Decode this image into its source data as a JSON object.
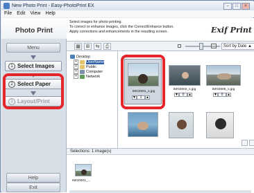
{
  "window": {
    "title": "New Photo Print - Easy-PhotoPrint EX",
    "controls": [
      "–",
      "□",
      "×"
    ]
  },
  "menu": [
    "File",
    "Edit",
    "View",
    "Help"
  ],
  "sidebar": {
    "brand": "Photo Print",
    "menu_label": "Menu",
    "steps": [
      {
        "num": "1",
        "label": "Select Images"
      },
      {
        "num": "2",
        "label": "Select Paper"
      },
      {
        "num": "3",
        "label": "Layout/Print"
      }
    ],
    "help_label": "Help",
    "exit_label": "Exit"
  },
  "instructions": [
    "Select images for photo printing.",
    "To correct or enhance images, click the Correct/Enhance button.",
    "Apply corrections and enhancements in the resulting screen."
  ],
  "logo": "Exif Print",
  "toolbar": {
    "icons": [
      "grid-view-icon",
      "tile-view-icon",
      "link-icon",
      "scan-icon"
    ]
  },
  "sort": {
    "value": "Sort by Date ▲",
    "option": "▼"
  },
  "tree": [
    {
      "label": "Desktop",
      "expander": ""
    },
    {
      "label": "UserName",
      "expander": "+"
    },
    {
      "label": "Public",
      "expander": "+"
    },
    {
      "label": "Computer",
      "expander": "+"
    },
    {
      "label": "Network",
      "expander": "+"
    }
  ],
  "thumbnails": [
    {
      "filename": "IMG0001_s.jpg",
      "count": "1"
    },
    {
      "filename": "IMG0002_s.jpg",
      "count": "0"
    },
    {
      "filename": "IMG0005_s.jpg",
      "count": "0"
    }
  ],
  "selections": {
    "header": "Selections: 1 image(s)",
    "item_label": "IMG0001_..."
  },
  "colors": {
    "highlight_ring": "#e4262b",
    "sidebar": "#d9dfe6"
  }
}
